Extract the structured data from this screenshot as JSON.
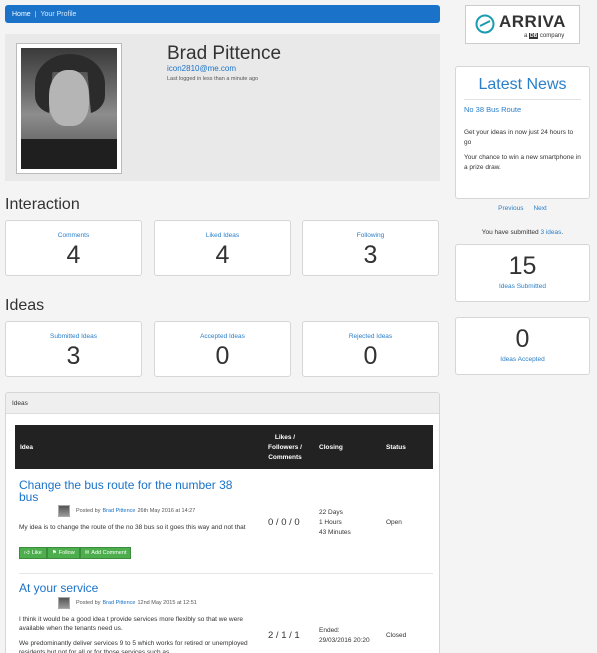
{
  "breadcrumb": {
    "home": "Home",
    "separator": "|",
    "current": "Your Profile"
  },
  "profile": {
    "name": "Brad Pittence",
    "email": "icon2810@me.com",
    "last_logged": "Last logged in less than a minute ago"
  },
  "interaction": {
    "title": "Interaction",
    "cards": [
      {
        "label": "Comments",
        "value": "4"
      },
      {
        "label": "Liked Ideas",
        "value": "4"
      },
      {
        "label": "Following",
        "value": "3"
      }
    ]
  },
  "ideas_summary": {
    "title": "Ideas",
    "cards": [
      {
        "label": "Submitted Ideas",
        "value": "3"
      },
      {
        "label": "Accepted Ideas",
        "value": "0"
      },
      {
        "label": "Rejected Ideas",
        "value": "0"
      }
    ]
  },
  "ideas_table": {
    "panel_title": "Ideas",
    "headers": {
      "idea": "Idea",
      "likes": "Likes / Followers / Comments",
      "closing": "Closing",
      "status": "Status"
    },
    "rows": [
      {
        "title": "Change the bus route for the number 38 bus",
        "posted_by_prefix": "Posted by",
        "author": "Brad Pittence",
        "date": "26th May 2016 at 14:27",
        "description": "My idea is to change the route of the no 38 bus so it goes this way and not that",
        "likes": "0 / 0 / 0",
        "closing": [
          "22 Days",
          "1 Hours",
          "43 Minutes"
        ],
        "status": "Open",
        "actions": {
          "like": "Like",
          "follow": "Follow",
          "comment": "Add Comment"
        }
      },
      {
        "title": "At your service",
        "posted_by_prefix": "Posted by",
        "author": "Brad Pittence",
        "date": "12nd May 2015 at 12:51",
        "description": "I think it would be a good idea t provide services more flexibly so that we were available when the tenants need us.",
        "description2": "We predominantly deliver services 9 to 5 which works for retired or unemployed residents but not for all or for those services such as",
        "likes": "2 / 1 / 1",
        "closing": [
          "Ended:",
          "29/03/2016 20:20"
        ],
        "status": "Closed"
      }
    ]
  },
  "sidebar": {
    "logo": {
      "word": "ARRIVA",
      "sub_prefix": "a",
      "sub_mark": "DB",
      "sub_suffix": "company"
    },
    "news": {
      "title": "Latest News",
      "item_title": "No 38 Bus Route",
      "para1": "Get your ideas in now just 24 hours to go",
      "para2": "Your chance to win a new smartphone in a prize draw."
    },
    "pager": {
      "previous": "Previous",
      "next": "Next"
    },
    "submitted_note": {
      "prefix": "You have submitted",
      "count": "3 ideas",
      "suffix": "."
    },
    "stats": [
      {
        "value": "15",
        "label": "Ideas Submitted"
      },
      {
        "value": "0",
        "label": "Ideas Accepted"
      }
    ]
  },
  "colors": {
    "accent": "#1a73c9",
    "button_green": "#4cae4c",
    "table_header": "#222222"
  },
  "icons": {
    "like": "thumbs-up-icon",
    "follow": "bookmark-icon",
    "comment": "comment-icon"
  }
}
